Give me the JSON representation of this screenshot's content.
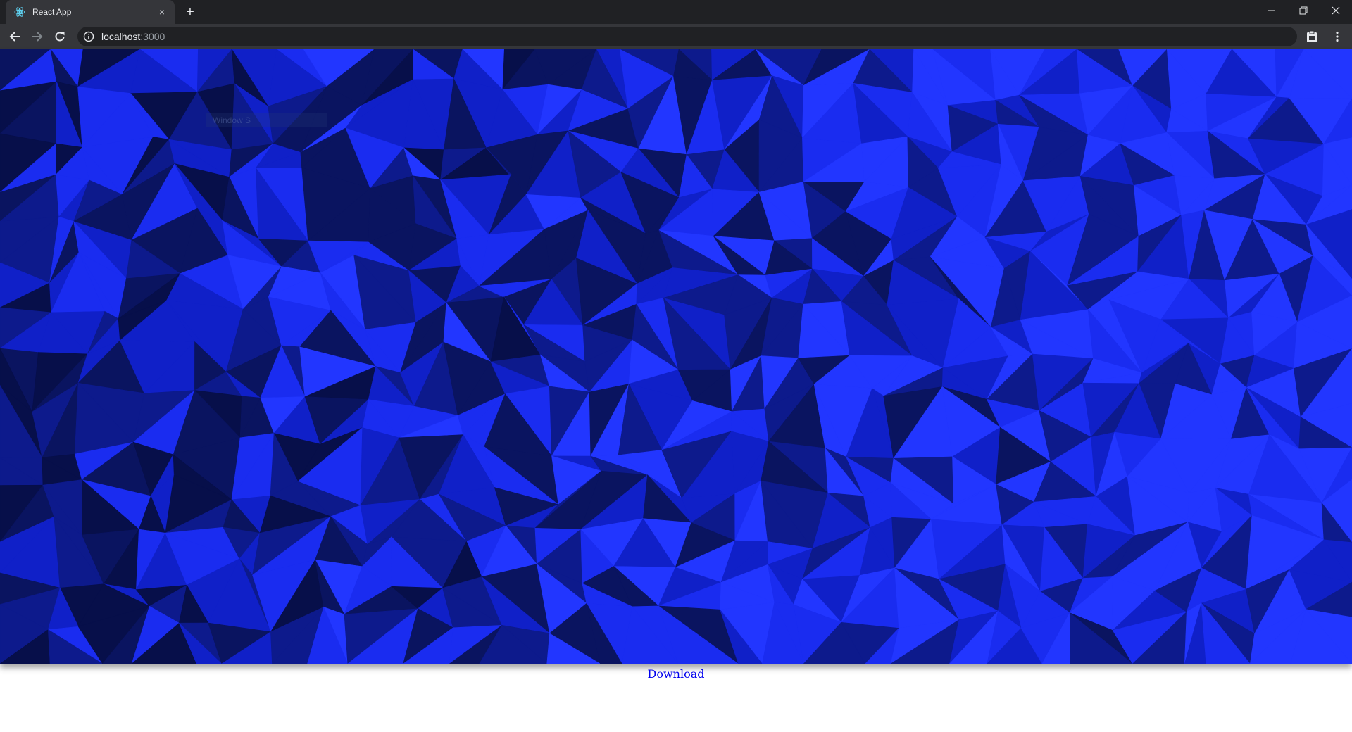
{
  "browser": {
    "tab_title": "React App",
    "tab_close": "×",
    "new_tab": "+",
    "url_host": "localhost",
    "url_port": ":3000",
    "icons": {
      "favicon": "react-logo-icon",
      "back": "back-arrow-icon",
      "forward": "forward-arrow-icon",
      "reload": "reload-icon",
      "info": "info-icon",
      "extension": "clipboard-extension-icon",
      "menu": "kebab-menu-icon",
      "minimize": "minimize-icon",
      "restore": "restore-icon",
      "close": "close-icon"
    }
  },
  "page": {
    "ghost_text": "Window S",
    "download_label": "Download",
    "background": {
      "style": "low-poly triangle pattern",
      "colors": [
        "#0a1460",
        "#0d1a8c",
        "#1020c8",
        "#1a2cf0",
        "#2236ff",
        "#070f4a"
      ]
    }
  }
}
